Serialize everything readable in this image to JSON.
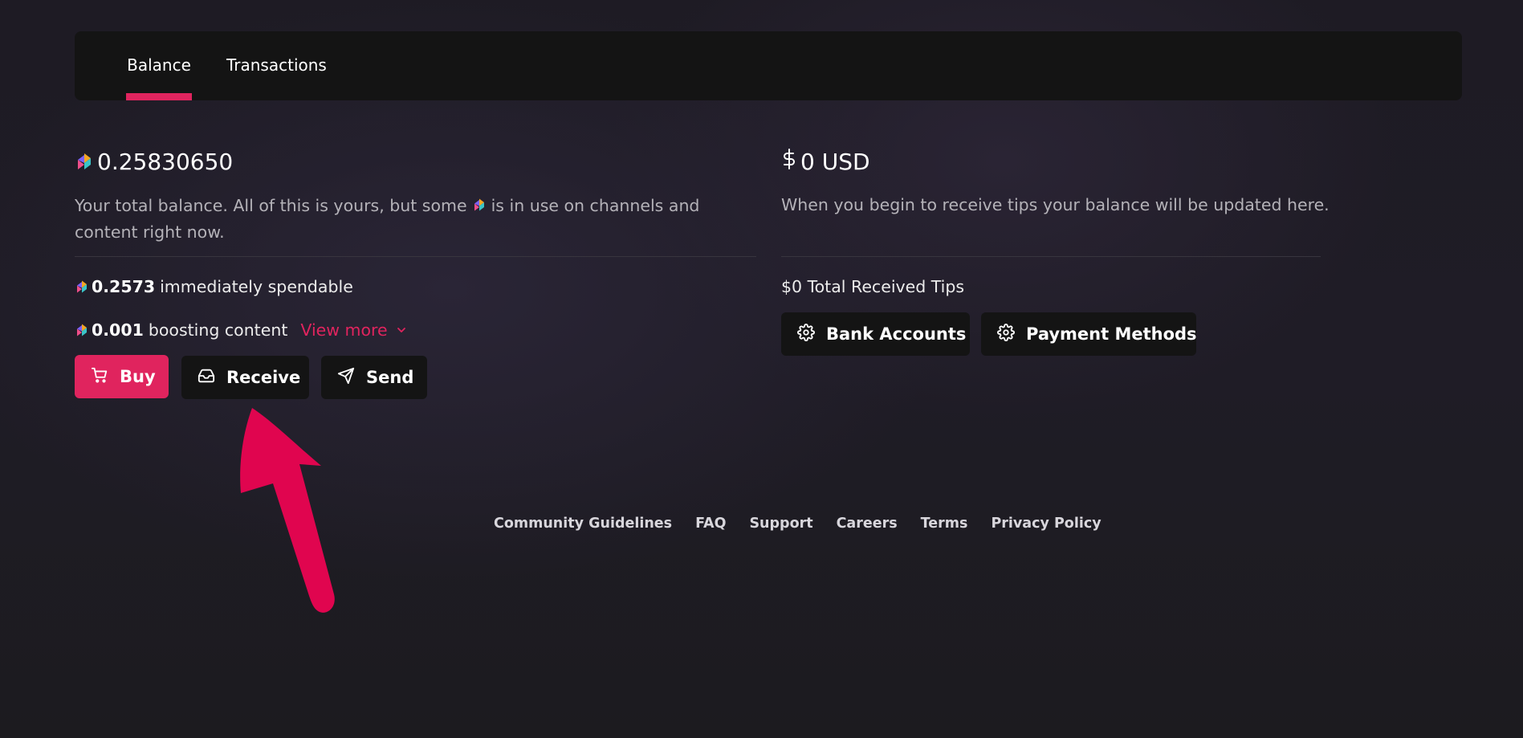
{
  "tabs": [
    {
      "label": "Balance",
      "active": true
    },
    {
      "label": "Transactions",
      "active": false
    }
  ],
  "credits": {
    "total": "0.25830650",
    "description_before": "Your total balance. All of this is yours, but some",
    "description_after": "is in use on channels and content right now.",
    "spendable_amount": "0.2573",
    "spendable_label": "immediately spendable",
    "boosting_amount": "0.001",
    "boosting_label": "boosting content",
    "view_more": "View more"
  },
  "actions": {
    "buy": "Buy",
    "receive": "Receive",
    "send": "Send"
  },
  "usd": {
    "total": "0 USD",
    "description": "When you begin to receive tips your balance will be updated here.",
    "total_tips": "$0 Total Received Tips",
    "bank_accounts": "Bank Accounts",
    "payment_methods": "Payment Methods"
  },
  "footer": {
    "links": [
      "Community Guidelines",
      "FAQ",
      "Support",
      "Careers",
      "Terms",
      "Privacy Policy"
    ]
  },
  "colors": {
    "accent": "#e0245e",
    "panel": "#141414",
    "background": "#1f1c26"
  },
  "icons": [
    "lbc-credit-icon",
    "dollar-icon",
    "cart-icon",
    "inbox-icon",
    "send-icon",
    "gear-icon",
    "chevron-down-icon"
  ]
}
